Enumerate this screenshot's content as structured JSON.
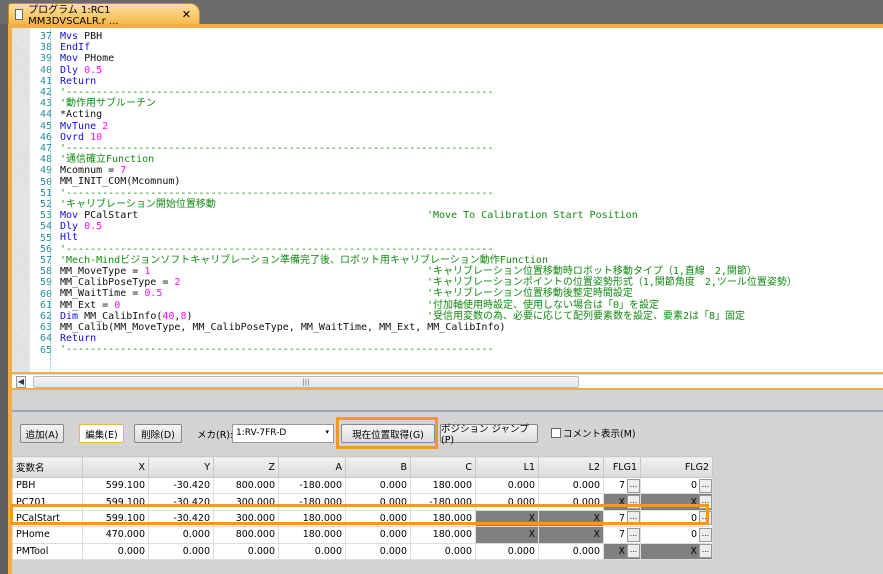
{
  "tab": {
    "title": "プログラム 1:RC1 MM3DVSCALR.r ...",
    "close": "✕"
  },
  "editor": {
    "lines": [
      {
        "n": "37",
        "parts": [
          [
            "k",
            "Mvs"
          ],
          [
            "",
            "PBH"
          ]
        ]
      },
      {
        "n": "38",
        "parts": [
          [
            "k",
            "EndIf"
          ]
        ]
      },
      {
        "n": "39",
        "parts": [
          [
            "k",
            "Mov"
          ],
          [
            "",
            "PHome"
          ]
        ]
      },
      {
        "n": "40",
        "parts": [
          [
            "k",
            "Dly"
          ],
          [
            "n",
            "0.5"
          ]
        ]
      },
      {
        "n": "41",
        "parts": [
          [
            "k",
            "Return"
          ]
        ]
      },
      {
        "n": "42",
        "parts": [
          [
            "c",
            "'-----------------------------------------------------------------------"
          ]
        ]
      },
      {
        "n": "43",
        "parts": [
          [
            "c",
            "'動作用サブルーチン"
          ]
        ]
      },
      {
        "n": "44",
        "parts": [
          [
            "",
            "*Acting"
          ]
        ]
      },
      {
        "n": "45",
        "parts": [
          [
            "k",
            "MvTune"
          ],
          [
            "n",
            "2"
          ]
        ]
      },
      {
        "n": "46",
        "parts": [
          [
            "k",
            "Ovrd"
          ],
          [
            "n",
            "10"
          ]
        ]
      },
      {
        "n": "47",
        "parts": [
          [
            "c",
            "'-----------------------------------------------------------------------"
          ]
        ]
      },
      {
        "n": "48",
        "parts": [
          [
            "c",
            "'通信確立Function"
          ]
        ]
      },
      {
        "n": "49",
        "parts": [
          [
            "",
            "Mcomnum ="
          ],
          [
            "n",
            "7"
          ]
        ]
      },
      {
        "n": "50",
        "parts": [
          [
            "",
            "MM_INIT_COM(Mcomnum)"
          ]
        ]
      },
      {
        "n": "51",
        "parts": [
          [
            "c",
            "'-----------------------------------------------------------------------"
          ]
        ]
      },
      {
        "n": "52",
        "parts": [
          [
            "c",
            "'キャリブレーション開始位置移動"
          ]
        ]
      },
      {
        "n": "53",
        "parts": [
          [
            "k",
            "Mov"
          ],
          [
            "",
            "PCalStart"
          ]
        ],
        "comment": "'Move To Calibration Start Position"
      },
      {
        "n": "54",
        "parts": [
          [
            "k",
            "Dly"
          ],
          [
            "n",
            "0.5"
          ]
        ]
      },
      {
        "n": "55",
        "parts": [
          [
            "k",
            "Hlt"
          ]
        ]
      },
      {
        "n": "56",
        "parts": [
          [
            "c",
            "'-----------------------------------------------------------------------"
          ]
        ]
      },
      {
        "n": "57",
        "parts": [
          [
            "c",
            "'Mech-Mindビジョンソフトキャリブレーション準備完了後、ロボット用キャリブレーション動作Function"
          ]
        ]
      },
      {
        "n": "58",
        "parts": [
          [
            "",
            "MM_MoveType ="
          ],
          [
            "n",
            "1"
          ]
        ],
        "comment": "'キャリブレーション位置移動時ロボット移動タイプ（1,直線　2,関節）"
      },
      {
        "n": "59",
        "parts": [
          [
            "",
            "MM_CalibPoseType ="
          ],
          [
            "n",
            "2"
          ]
        ],
        "comment": "'キャリブレーションポイントの位置姿勢形式（1,関節角度　2,ツール位置姿勢）"
      },
      {
        "n": "60",
        "parts": [
          [
            "",
            "MM_WaitTime ="
          ],
          [
            "n",
            "0.5"
          ]
        ],
        "comment": "'キャリブレーション位置移動後整定時間設定"
      },
      {
        "n": "61",
        "parts": [
          [
            "",
            "MM_Ext ="
          ],
          [
            "n",
            "0"
          ]
        ],
        "comment": "'付加軸使用時設定、使用しない場合は「0」を設定"
      },
      {
        "n": "62",
        "parts": [
          [
            "k",
            "Dim"
          ],
          [
            "",
            "MM_CalibInfo("
          ],
          [
            "n",
            "40"
          ],
          [
            "",
            ","
          ],
          [
            "n",
            "8"
          ],
          [
            "",
            ")"
          ]
        ],
        "comment": "'受信用変数の為、必要に応じて配列要素数を設定、要素2は「8」固定"
      },
      {
        "n": "63",
        "parts": [
          [
            "",
            "MM_Calib(MM_MoveType, MM_CalibPoseType, MM_WaitTime, MM_Ext, MM_CalibInfo)"
          ]
        ]
      },
      {
        "n": "64",
        "parts": [
          [
            "k",
            "Return"
          ]
        ]
      },
      {
        "n": "65",
        "parts": [
          [
            "c",
            "'-----------------------------------------------------------------------"
          ]
        ]
      }
    ]
  },
  "toolbar": {
    "add": "追加(A)",
    "edit": "編集(E)",
    "delete": "削除(D)",
    "maker_label": "メカ(R):",
    "maker_value": "1:RV-7FR-D",
    "get_current": "現在位置取得(G)",
    "jump": "ポジション ジャンプ(P)",
    "comment_toggle": "コメント表示(M)"
  },
  "table": {
    "headers": [
      "変数名",
      "X",
      "Y",
      "Z",
      "A",
      "B",
      "C",
      "L1",
      "L2",
      "FLG1",
      "FLG2"
    ],
    "rows": [
      [
        "PBH",
        "599.100",
        "-30.420",
        "800.000",
        "-180.000",
        "0.000",
        "180.000",
        "0.000",
        "0.000",
        "7",
        "0"
      ],
      [
        "PC701",
        "599.100",
        "-30.420",
        "300.000",
        "-180.000",
        "0.000",
        "-180.000",
        "0.000",
        "0.000",
        "X",
        "X"
      ],
      [
        "PCalStart",
        "599.100",
        "-30.420",
        "300.000",
        "180.000",
        "0.000",
        "180.000",
        "X",
        "X",
        "7",
        "0"
      ],
      [
        "PHome",
        "470.000",
        "0.000",
        "800.000",
        "180.000",
        "0.000",
        "180.000",
        "X",
        "X",
        "7",
        "0"
      ],
      [
        "PMTool",
        "0.000",
        "0.000",
        "0.000",
        "0.000",
        "0.000",
        "0.000",
        "0.000",
        "0.000",
        "X",
        "X"
      ]
    ],
    "ellipsis": "..."
  },
  "colors": {
    "highlight": "#f39a1e",
    "tab": "#f7b94a"
  }
}
